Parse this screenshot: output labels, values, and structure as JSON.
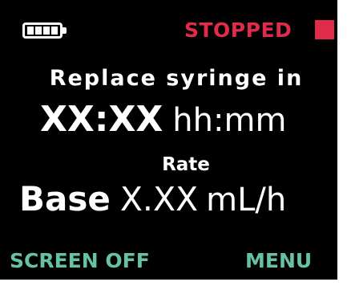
{
  "status_bar": {
    "battery_icon": "battery-full-icon",
    "battery_segments": 4,
    "status_text": "STOPPED",
    "status_icon": "stop-square-icon",
    "status_color": "#e12b4a"
  },
  "main": {
    "replace_label": "Replace syringe in",
    "time_value": "XX:XX",
    "time_unit": "hh:mm",
    "rate_label": "Rate",
    "rate_mode": "Base",
    "rate_value": "X.XX",
    "rate_unit": "mL/h"
  },
  "softkeys": {
    "left_label": "SCREEN OFF",
    "right_label": "MENU",
    "color": "#66c2a5"
  },
  "colors": {
    "background": "#000000",
    "text": "#ffffff"
  }
}
